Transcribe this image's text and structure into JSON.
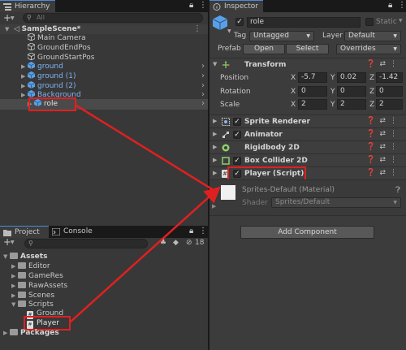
{
  "hierarchy": {
    "tab_label": "Hierarchy",
    "add_label": "+",
    "search_placeholder": "All",
    "scene_label": "SampleScene*",
    "items": [
      {
        "label": "Main Camera"
      },
      {
        "label": "GroundEndPos"
      },
      {
        "label": "GroundStartPos"
      },
      {
        "label": "ground"
      },
      {
        "label": "ground (1)"
      },
      {
        "label": "ground (2)"
      },
      {
        "label": "Background"
      },
      {
        "label": "role"
      }
    ]
  },
  "project": {
    "tab_project": "Project",
    "tab_console": "Console",
    "add_label": "+",
    "hidden_count": "18",
    "tree": [
      {
        "label": "Assets"
      },
      {
        "label": "Editor"
      },
      {
        "label": "GameRes"
      },
      {
        "label": "RawAssets"
      },
      {
        "label": "Scenes"
      },
      {
        "label": "Scripts"
      },
      {
        "label": "Ground"
      },
      {
        "label": "Player"
      },
      {
        "label": "Packages"
      }
    ]
  },
  "inspector": {
    "tab_label": "Inspector",
    "object_name": "role",
    "static_label": "Static",
    "tag_label": "Tag",
    "tag_value": "Untagged",
    "layer_label": "Layer",
    "layer_value": "Default",
    "prefab_label": "Prefab",
    "open_button": "Open",
    "select_button": "Select",
    "overrides_label": "Overrides",
    "transform": {
      "title": "Transform",
      "position_label": "Position",
      "rotation_label": "Rotation",
      "scale_label": "Scale",
      "x_label": "X",
      "y_label": "Y",
      "z_label": "Z",
      "position": {
        "x": "-5.7",
        "y": "0.02",
        "z": "-1.42"
      },
      "rotation": {
        "x": "0",
        "y": "0",
        "z": "0"
      },
      "scale": {
        "x": "2",
        "y": "2",
        "z": "2"
      }
    },
    "components": [
      {
        "label": "Sprite Renderer"
      },
      {
        "label": "Animator"
      },
      {
        "label": "Rigidbody 2D"
      },
      {
        "label": "Box Collider 2D"
      },
      {
        "label": "Player (Script)"
      }
    ],
    "material": {
      "name": "Sprites-Default (Material)",
      "shader_label": "Shader",
      "shader_value": "Sprites/Default"
    },
    "add_component_label": "Add Component"
  },
  "colors": {
    "highlight": "#e02020",
    "accent_blue": "#7fb3f5",
    "selection": "#2c5d87"
  }
}
